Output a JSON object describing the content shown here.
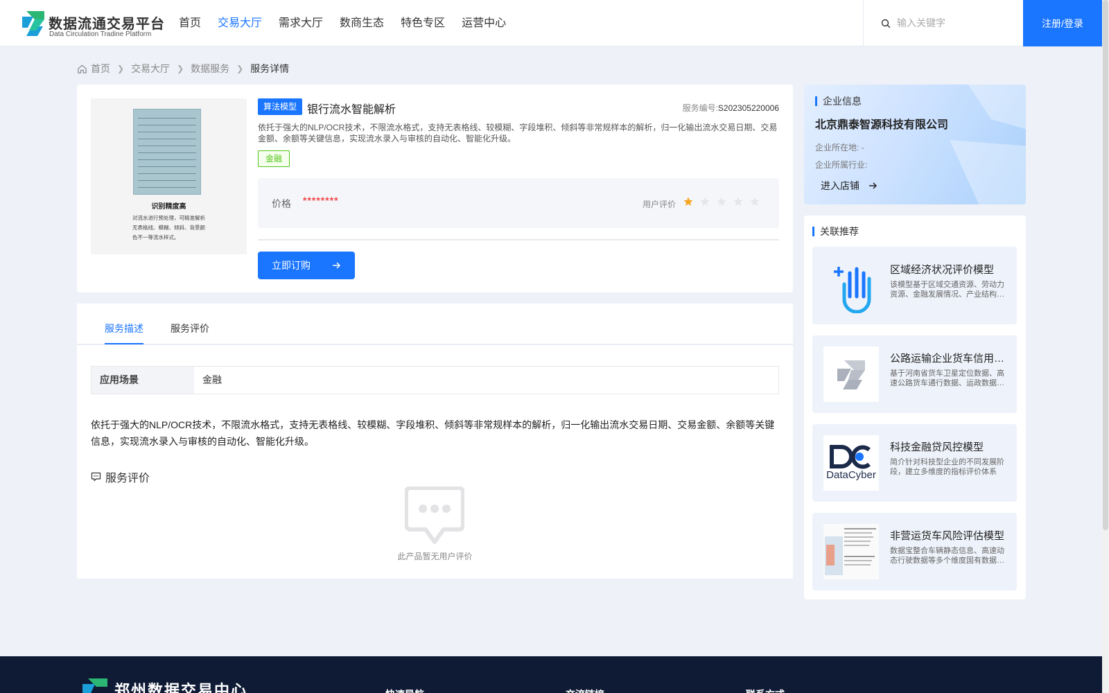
{
  "header": {
    "logo_title": "数据流通交易平台",
    "logo_subtitle": "Data Circulation Tradine Platform",
    "nav": [
      {
        "label": "首页",
        "active": false
      },
      {
        "label": "交易大厅",
        "active": true
      },
      {
        "label": "需求大厅",
        "active": false
      },
      {
        "label": "数商生态",
        "active": false
      },
      {
        "label": "特色专区",
        "active": false
      },
      {
        "label": "运营中心",
        "active": false
      }
    ],
    "search_placeholder": "输入关键字",
    "login_label": "注册/登录"
  },
  "breadcrumb": [
    "首页",
    "交易大厅",
    "数据服务",
    "服务详情"
  ],
  "product": {
    "category_tag": "算法模型",
    "title": "银行流水智能解析",
    "service_no_label": "服务编号:",
    "service_no": "S202305220006",
    "description": "依托于强大的NLP/OCR技术，不限流水格式，支持无表格线、较模糊、字段堆积、倾斜等非常规样本的解析，归一化输出流水交易日期、交易金额、余额等关键信息，实现流水录入与审核的自动化、智能化升级。",
    "industry_tag": "金融",
    "price_label": "价格",
    "price_value": "********",
    "rating_label": "用户评价",
    "rating": 1,
    "rating_max": 5,
    "order_label": "立即订购",
    "thumb_title": "识别精度高",
    "thumb_desc": "对流水进行预处理，可精准解析无表格线、模糊、倾斜、背景颜色不一等流水样式。"
  },
  "detail": {
    "tabs": [
      {
        "label": "服务描述",
        "active": true
      },
      {
        "label": "服务评价",
        "active": false
      }
    ],
    "scene_key": "应用场景",
    "scene_value": "金融",
    "text": "依托于强大的NLP/OCR技术，不限流水格式，支持无表格线、较模糊、字段堆积、倾斜等非常规样本的解析，归一化输出流水交易日期、交易金额、余额等关键信息，实现流水录入与审核的自动化、智能化升级。",
    "review_heading": "服务评价",
    "empty_text": "此产品暂无用户评价"
  },
  "company": {
    "section_title": "企业信息",
    "name": "北京鼎泰智源科技有限公司",
    "location_label": "企业所在地:",
    "location_value": "-",
    "industry_label": "企业所属行业:",
    "industry_value": "",
    "shop_label": "进入店铺"
  },
  "recommend": {
    "section_title": "关联推荐",
    "items": [
      {
        "title": "区域经济状况评价模型",
        "desc": "该模型基于区域交通资源、劳动力资源、金融发展情况、产业结构等数据进行综合评价",
        "icon": "hand-plus-icon"
      },
      {
        "title": "公路运输企业货车信用评分",
        "desc": "基于河南省货车卫星定位数据、高速公路货车通行数据、运政数据等构建评分模型",
        "icon": "platform-logo-icon"
      },
      {
        "title": "科技金融贷风控模型",
        "desc": "简介针对科技型企业的不同发展阶段，建立多维度的指标评价体系",
        "icon": "datacyber-logo-icon"
      },
      {
        "title": "非营运货车风险评估模型",
        "desc": "数据宝整合车辆静态信息、高速动态行驶数据等多个维度国有数据资源",
        "icon": "document-thumb-icon"
      }
    ],
    "datacyber_text": "DataCyber"
  },
  "footer": {
    "name": "郑州数据交易中心",
    "columns": [
      "快速导航",
      "交流链接",
      "联系方式"
    ]
  },
  "colors": {
    "primary": "#1a75ff",
    "price": "#f04848",
    "finance_tag": "#52c41a",
    "star_active": "#f5a623",
    "footer_bg": "#0f1a35"
  }
}
